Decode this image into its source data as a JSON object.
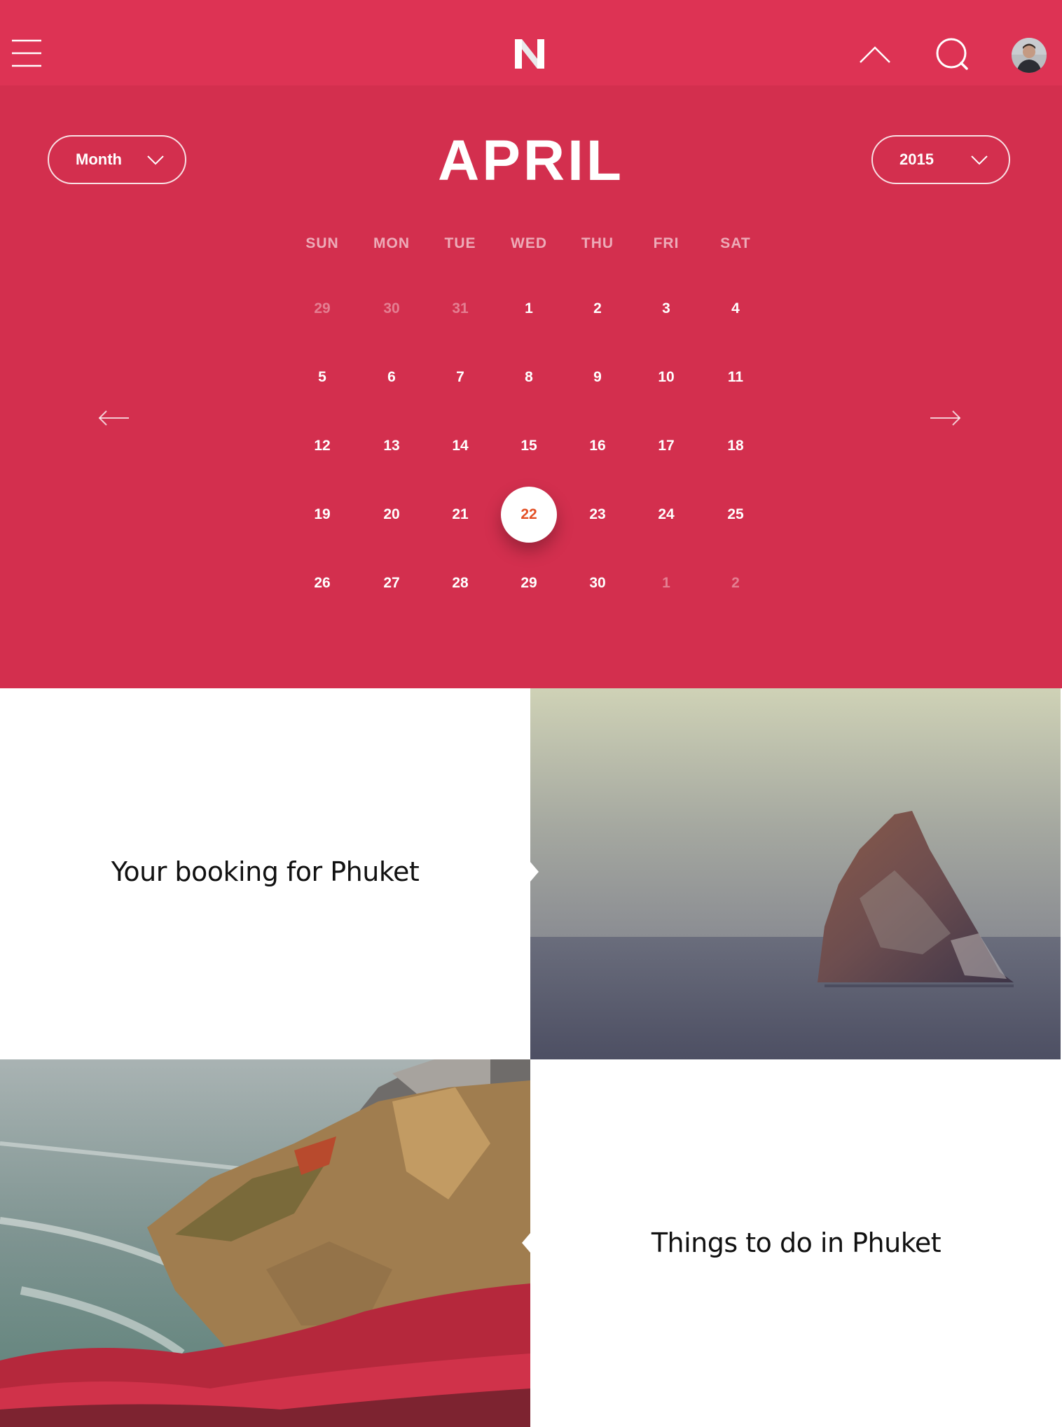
{
  "header": {
    "logo": "N",
    "menu_icon": "hamburger-menu-icon",
    "collapse_icon": "chevron-up-icon",
    "search_icon": "search-icon",
    "avatar_icon": "user-avatar"
  },
  "calendar": {
    "month_select": "Month",
    "year_select": "2015",
    "title": "APRIL",
    "weekdays": [
      "SUN",
      "MON",
      "TUE",
      "WED",
      "THU",
      "FRI",
      "SAT"
    ],
    "weeks": [
      [
        "29",
        "30",
        "31",
        "1",
        "2",
        "3",
        "4"
      ],
      [
        "5",
        "6",
        "7",
        "8",
        "9",
        "10",
        "11"
      ],
      [
        "12",
        "13",
        "14",
        "15",
        "16",
        "17",
        "18"
      ],
      [
        "19",
        "20",
        "21",
        "22",
        "23",
        "24",
        "25"
      ],
      [
        "26",
        "27",
        "28",
        "29",
        "30",
        "1",
        "2"
      ]
    ],
    "muted_cells": [
      [
        0,
        0
      ],
      [
        0,
        1
      ],
      [
        0,
        2
      ],
      [
        4,
        5
      ],
      [
        4,
        6
      ]
    ],
    "selected_cell": [
      3,
      3
    ],
    "prev_icon": "arrow-left-icon",
    "next_icon": "arrow-right-icon"
  },
  "cards": {
    "booking": "Your booking for Phuket",
    "things": "Things to do in Phuket"
  },
  "colors": {
    "header": "#dd3354",
    "calendar": "#d32f4e",
    "selected_day_text": "#e34f24"
  }
}
